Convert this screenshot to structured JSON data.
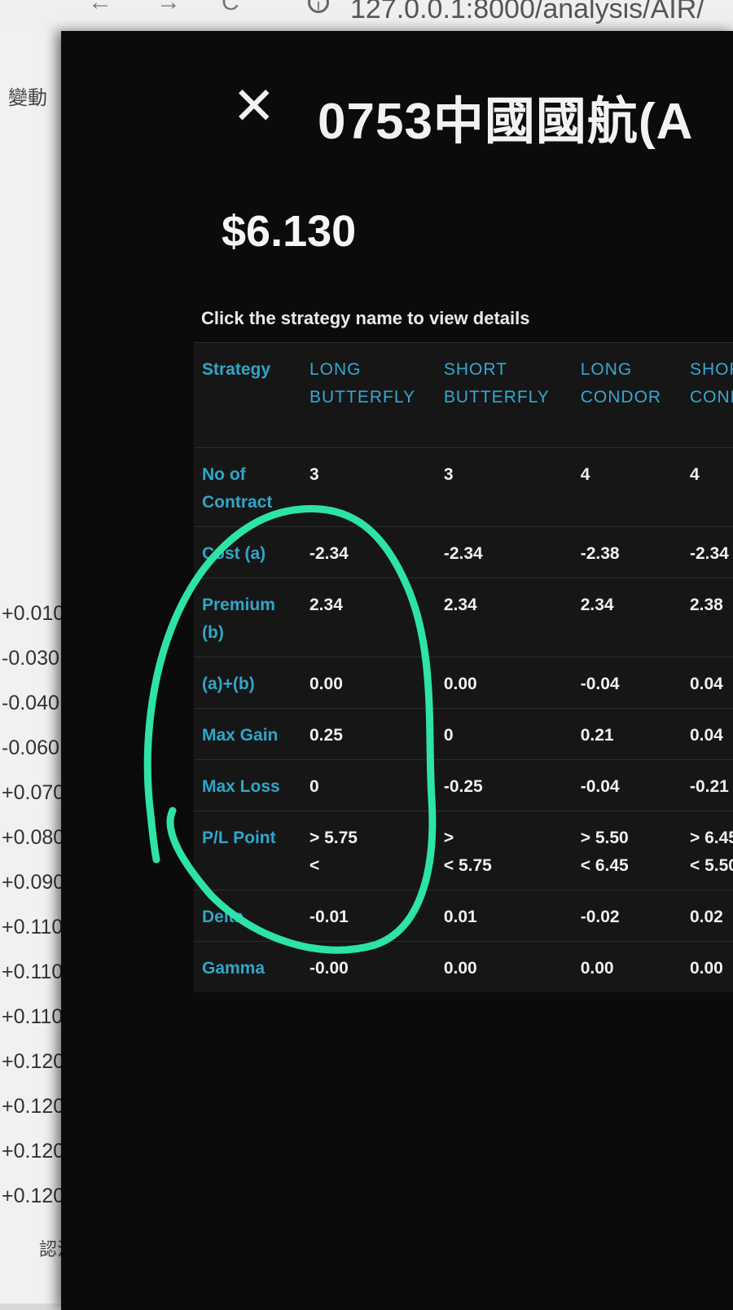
{
  "browser": {
    "back_glyph": "←",
    "forward_glyph": "→",
    "reload_glyph": "C",
    "info_glyph": "i",
    "url": "127.0.0.1:8000/analysis/AIR/"
  },
  "background_page": {
    "header": "變動",
    "values": [
      "+0.010",
      "-0.030",
      "-0.040",
      "-0.060",
      "+0.070",
      "+0.080",
      "+0.090",
      "+0.110",
      "+0.110",
      "+0.110",
      "+0.120",
      "+0.120",
      "+0.120",
      "+0.120"
    ],
    "footer": "認沽"
  },
  "modal": {
    "close_glyph": "✕",
    "title": "0753中國國航(A",
    "price": "$6.130",
    "hint": "Click the strategy name to view details"
  },
  "table": {
    "header_label": "Strategy",
    "strategies": [
      "LONG BUTTERFLY",
      "SHORT BUTTERFLY",
      "LONG CONDOR",
      "SHOR COND"
    ],
    "rows": [
      {
        "label": "No of Contract",
        "values": [
          "3",
          "3",
          "4",
          "4"
        ]
      },
      {
        "label": "Cost (a)",
        "values": [
          "-2.34",
          "-2.34",
          "-2.38",
          "-2.34"
        ]
      },
      {
        "label": "Premium (b)",
        "values": [
          "2.34",
          "2.34",
          "2.34",
          "2.38"
        ]
      },
      {
        "label": "(a)+(b)",
        "values": [
          "0.00",
          "0.00",
          "-0.04",
          "0.04"
        ]
      },
      {
        "label": "Max Gain",
        "values": [
          "0.25",
          "0",
          "0.21",
          "0.04"
        ]
      },
      {
        "label": "Max Loss",
        "values": [
          "0",
          "-0.25",
          "-0.04",
          "-0.21"
        ]
      },
      {
        "label": "P/L Point",
        "values": [
          "> 5.75\n<",
          ">\n< 5.75",
          "> 5.50\n< 6.45",
          "> 6.45\n< 5.50"
        ]
      },
      {
        "label": "Delta",
        "values": [
          "-0.01",
          "0.01",
          "-0.02",
          "0.02"
        ]
      },
      {
        "label": "Gamma",
        "values": [
          "-0.00",
          "0.00",
          "0.00",
          "0.00"
        ]
      }
    ]
  },
  "colors": {
    "annotation": "#2de3a8",
    "label_blue": "#2fa6c9",
    "modal_bg": "#0b0b0b"
  }
}
